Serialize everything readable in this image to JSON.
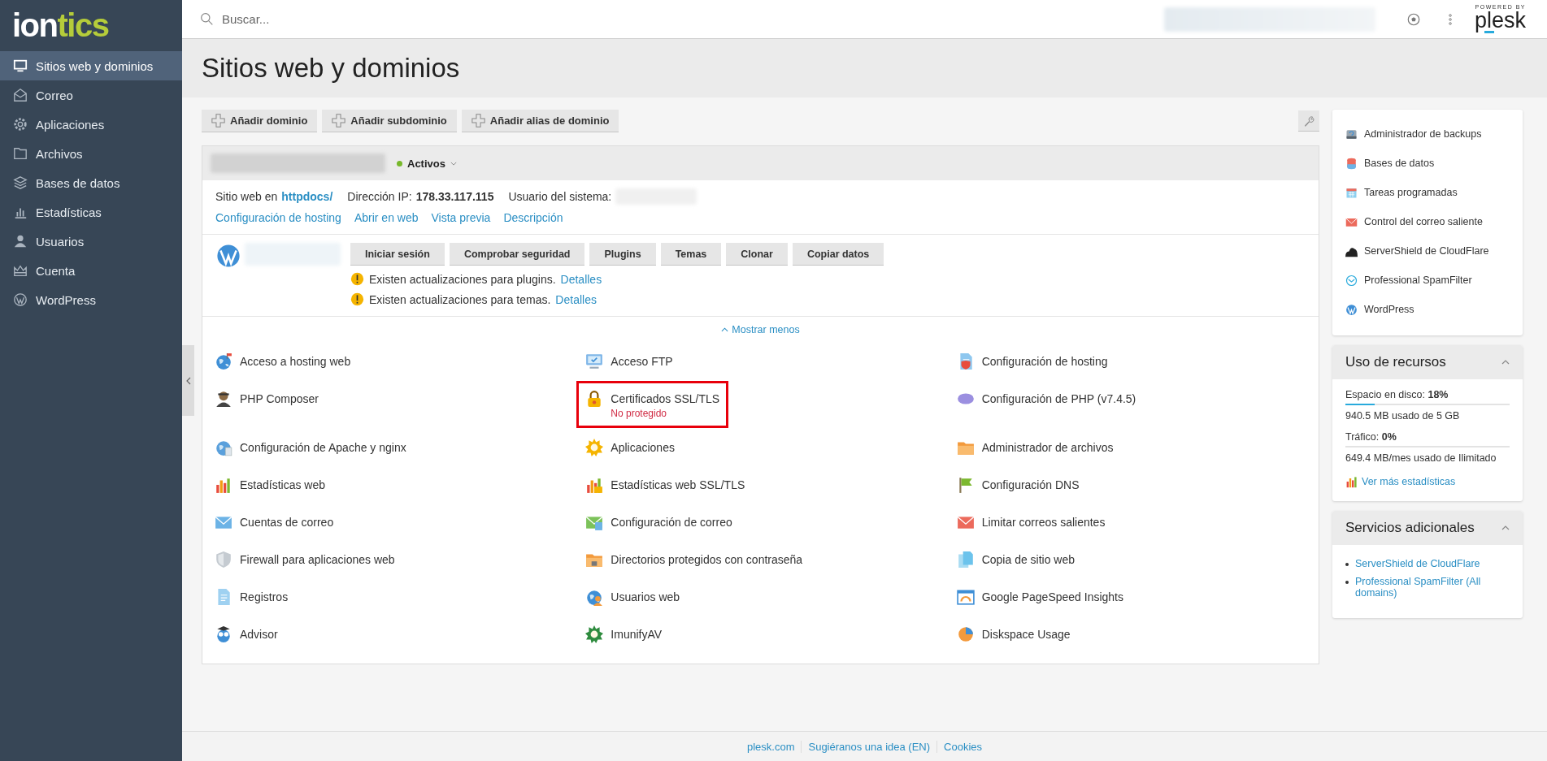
{
  "logo": [
    {
      "text": "ion",
      "color": "#ffffff"
    },
    {
      "text": "tics",
      "color": "#b5cc3a"
    }
  ],
  "sidebar": {
    "items": [
      {
        "label": "Sitios web y dominios",
        "selected": true
      },
      {
        "label": "Correo",
        "selected": false
      },
      {
        "label": "Aplicaciones",
        "selected": false
      },
      {
        "label": "Archivos",
        "selected": false
      },
      {
        "label": "Bases de datos",
        "selected": false
      },
      {
        "label": "Estadísticas",
        "selected": false
      },
      {
        "label": "Usuarios",
        "selected": false
      },
      {
        "label": "Cuenta",
        "selected": false
      },
      {
        "label": "WordPress",
        "selected": false
      }
    ]
  },
  "header": {
    "search": {
      "placeholder": "Buscar..."
    },
    "brand": {
      "caption": "POWERED BY",
      "name": "plesk"
    }
  },
  "page_title": "Sitios web y dominios",
  "toolbar": {
    "buttons": [
      "Añadir dominio",
      "Añadir subdominio",
      "Añadir alias de dominio"
    ]
  },
  "domain": {
    "status": {
      "label": "Activos",
      "color": "#77b82a"
    },
    "info": [
      {
        "label": "Sitio web en",
        "value": "httpdocs/",
        "kind": "link"
      },
      {
        "label": "Dirección IP:",
        "value": "178.33.117.115",
        "kind": "bold"
      },
      {
        "label": "Usuario del sistema:",
        "kind": "hidden"
      }
    ],
    "links": [
      "Configuración de hosting",
      "Abrir en web",
      "Vista previa",
      "Descripción"
    ],
    "wordpress": {
      "buttons": [
        "Iniciar sesión",
        "Comprobar seguridad",
        "Plugins",
        "Temas",
        "Clonar",
        "Copiar datos"
      ],
      "notices": [
        {
          "text": "Existen actualizaciones para plugins.",
          "link": "Detalles"
        },
        {
          "text": "Existen actualizaciones para temas.",
          "link": "Detalles"
        }
      ]
    },
    "toggle": "Mostrar menos",
    "tools": [
      {
        "label": "Acceso a hosting web",
        "highlighted": false
      },
      {
        "label": "Acceso FTP",
        "highlighted": false
      },
      {
        "label": "Configuración de hosting",
        "highlighted": false
      },
      {
        "label": "PHP Composer",
        "highlighted": false
      },
      {
        "label": "Certificados SSL/TLS",
        "status": "No protegido",
        "highlighted": true
      },
      {
        "label": "Configuración de PHP (v7.4.5)",
        "highlighted": false
      },
      {
        "label": "Configuración de Apache y nginx",
        "highlighted": false
      },
      {
        "label": "Aplicaciones",
        "highlighted": false
      },
      {
        "label": "Administrador de archivos",
        "highlighted": false
      },
      {
        "label": "Estadísticas web",
        "highlighted": false
      },
      {
        "label": "Estadísticas web SSL/TLS",
        "highlighted": false
      },
      {
        "label": "Configuración DNS",
        "highlighted": false
      },
      {
        "label": "Cuentas de correo",
        "highlighted": false
      },
      {
        "label": "Configuración de correo",
        "highlighted": false
      },
      {
        "label": "Limitar correos salientes",
        "highlighted": false
      },
      {
        "label": "Firewall para aplicaciones web",
        "highlighted": false
      },
      {
        "label": "Directorios protegidos con contraseña",
        "highlighted": false
      },
      {
        "label": "Copia de sitio web",
        "highlighted": false
      },
      {
        "label": "Registros",
        "highlighted": false
      },
      {
        "label": "Usuarios web",
        "highlighted": false
      },
      {
        "label": "Google PageSpeed Insights",
        "highlighted": false
      },
      {
        "label": "Advisor",
        "highlighted": false
      },
      {
        "label": "ImunifyAV",
        "highlighted": false
      },
      {
        "label": "Diskspace Usage",
        "highlighted": false
      }
    ]
  },
  "right": {
    "quick_links": [
      "Administrador de backups",
      "Bases de datos",
      "Tareas programadas",
      "Control del correo saliente",
      "ServerShield de CloudFlare",
      "Professional SpamFilter",
      "WordPress"
    ],
    "resources": {
      "title": "Uso de recursos",
      "expanded": true,
      "metrics": [
        {
          "label": "Espacio en disco:",
          "value": "18%",
          "level": 0.18,
          "detail": "940.5 MB usado de 5 GB"
        },
        {
          "label": "Tráfico:",
          "value": "0%",
          "level": 0,
          "detail": "649.4 MB/mes usado de Ilimitado"
        }
      ],
      "link": "Ver más estadísticas"
    },
    "services": {
      "title": "Servicios adicionales",
      "expanded": true,
      "items": [
        "ServerShield de CloudFlare",
        "Professional SpamFilter (All domains)"
      ]
    }
  },
  "footer": {
    "links": [
      "plesk.com",
      "Sugiéranos una idea (EN)",
      "Cookies"
    ]
  }
}
